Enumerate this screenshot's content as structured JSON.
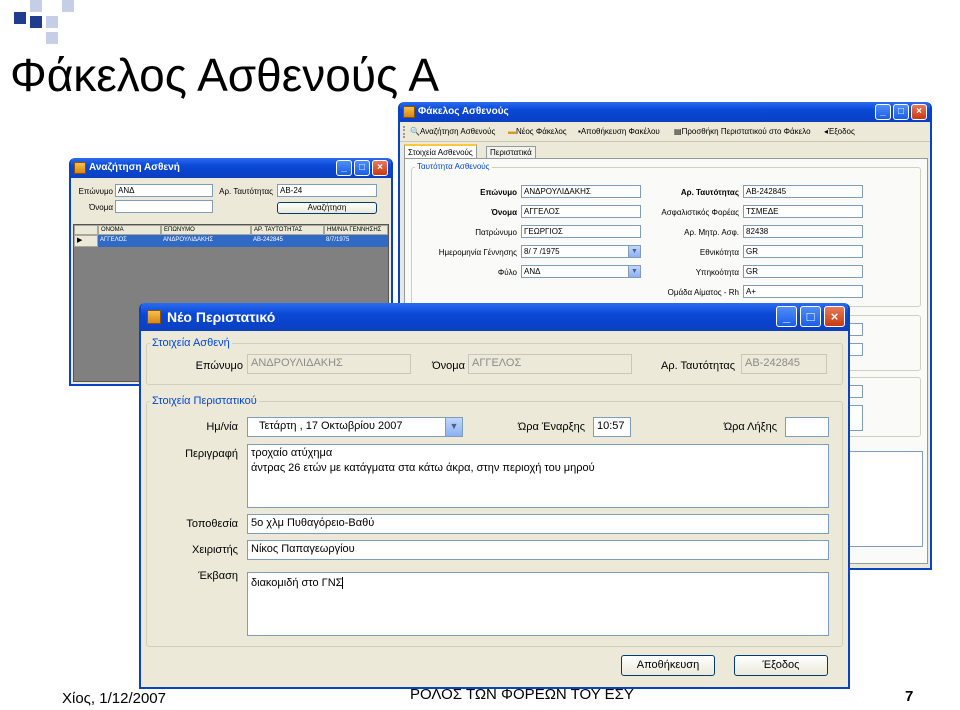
{
  "slide": {
    "title": "Φάκελος Ασθενούς Α",
    "footer_left": "Χίος, 1/12/2007",
    "footer_center": "ΡΟΛΟΣ ΤΩΝ ΦΟΡΕΩΝ ΤΟΥ ΕΣΥ",
    "page_number": "7"
  },
  "folder_window": {
    "title": "Φάκελος Ασθενούς",
    "toolbar": [
      {
        "label": "Αναζήτηση Ασθενούς",
        "icon": "binoculars-icon"
      },
      {
        "label": "Νέος Φάκελος",
        "icon": "folder-icon"
      },
      {
        "label": "Αποθήκευση Φακέλου",
        "icon": "save-icon"
      },
      {
        "label": "Προσθήκη Περιστατικού στο Φάκελο",
        "icon": "add-record-icon"
      },
      {
        "label": "Έξοδος",
        "icon": "exit-icon"
      }
    ],
    "tabs": [
      "Στοιχεία Ασθενούς",
      "Περιστατικά"
    ],
    "group_title": "Ταυτότητα Ασθενούς",
    "fields": {
      "surname_label": "Επώνυμο",
      "surname": "ΑΝΔΡΟΥΛΙΔΑΚΗΣ",
      "name_label": "Όνομα",
      "name": "ΑΓΓΕΛΟΣ",
      "father_label": "Πατρώνυμο",
      "father": "ΓΕΩΡΓΙΟΣ",
      "birth_label": "Ημερομηνία Γέννησης",
      "birth": "8/ 7 /1975",
      "sex_label": "Φύλο",
      "sex": "ΑΝΔ",
      "id_label": "Αρ. Ταυτότητας",
      "id": "ΑΒ-242845",
      "insurer_label": "Ασφαλιστικός Φορέας",
      "insurer": "ΤΣΜΕΔΕ",
      "insno_label": "Αρ. Μητρ. Ασφ.",
      "insno": "82438",
      "nationality_label": "Εθνικότητα",
      "nationality": "GR",
      "citizenship_label": "Υπηκοότητα",
      "citizenship": "GR",
      "blood_label": "Ομάδα Αίματος - Rh",
      "blood": "A+"
    }
  },
  "search_window": {
    "title": "Αναζήτηση Ασθενή",
    "surname_label": "Επώνυμο",
    "surname_value": "ΑΝΔ",
    "id_label": "Αρ. Ταυτότητας",
    "id_value": "ΑΒ-24",
    "name_label": "Όνομα",
    "name_value": "",
    "search_button": "Αναζήτηση",
    "columns": [
      "ΟΝΟΜΑ",
      "ΕΠΩΝΥΜΟ",
      "ΑΡ. ΤΑΥΤΟΤΗΤΑΣ",
      "ΗΜ/ΝΙΑ ΓΕΝΝΗΣΗΣ"
    ],
    "rows": [
      [
        "ΑΓΓΕΛΟΣ",
        "ΑΝΔΡΟΥΛΙΔΑΚΗΣ",
        "ΑΒ-242845",
        "8/7/1975"
      ]
    ]
  },
  "new_case_window": {
    "title": "Νέο Περιστατικό",
    "patient_group": "Στοιχεία Ασθενή",
    "surname_label": "Επώνυμο",
    "surname": "ΑΝΔΡΟΥΛΙΔΑΚΗΣ",
    "name_label": "Όνομα",
    "name": "ΑΓΓΕΛΟΣ",
    "id_label": "Αρ. Ταυτότητας",
    "id": "ΑΒ-242845",
    "case_group": "Στοιχεία Περιστατικού",
    "date_label": "Ημ/νία",
    "date": "Τετάρτη   , 17   Οκτωβρίου   2007",
    "start_label": "Ώρα Έναρξης",
    "start": "10:57",
    "end_label": "Ώρα Λήξης",
    "end": "",
    "desc_label": "Περιγραφή",
    "desc_line1": "τροχαίο ατύχημα",
    "desc_line2": "άντρας 26 ετών με κατάγματα στα κάτω άκρα, στην περιοχή του μηρού",
    "location_label": "Τοποθεσία",
    "location": "5ο χλμ Πυθαγόρειο-Βαθύ",
    "operator_label": "Χειριστής",
    "operator": "Νίκος Παπαγεωργίου",
    "outcome_label": "Έκβαση",
    "outcome": "διακομιδή στο ΓΝΣ",
    "save_button": "Αποθήκευση",
    "exit_button": "Έξοδος"
  },
  "colors": {
    "accent": "#0a48d6",
    "group_title": "#0046d5",
    "grid_bg": "#808080",
    "selected_row": "#316ac5"
  }
}
